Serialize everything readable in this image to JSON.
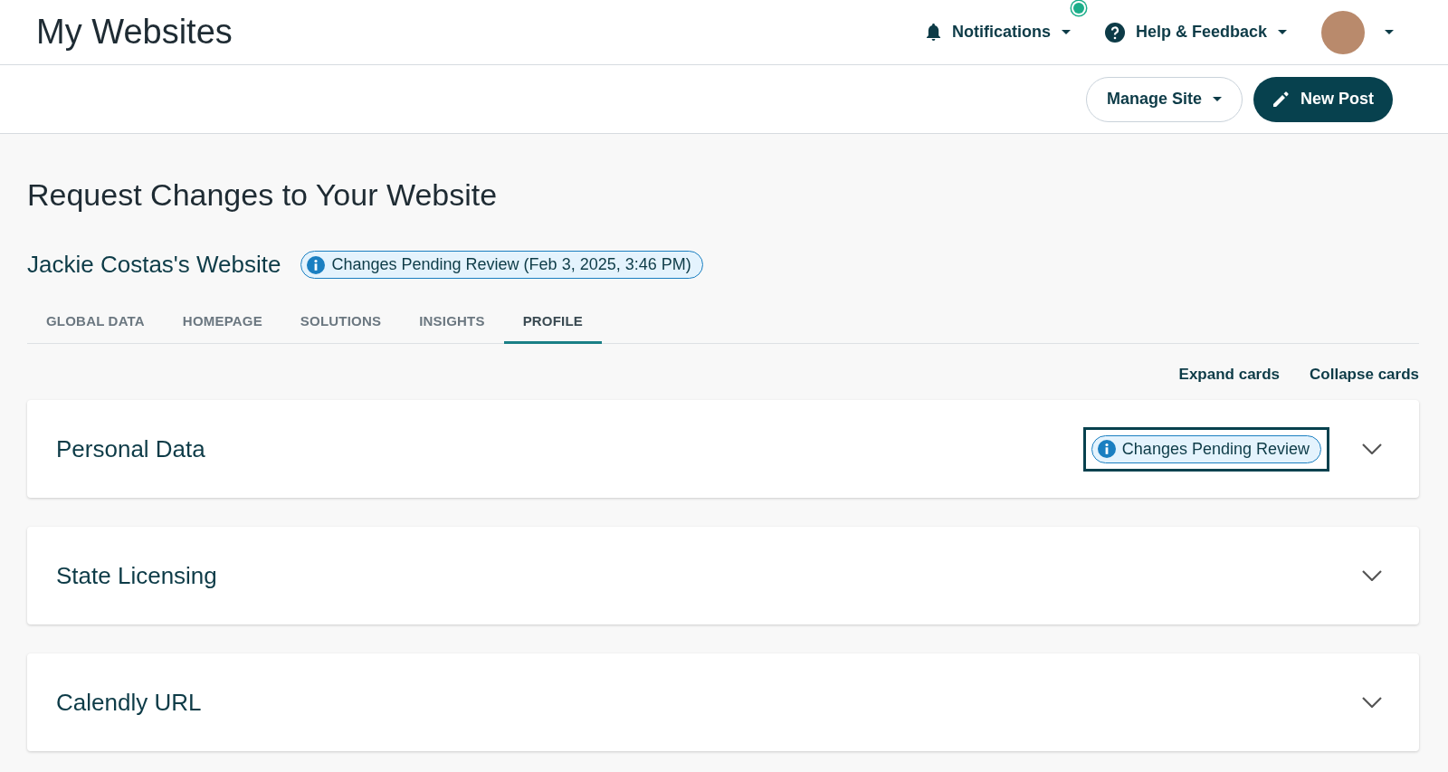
{
  "header": {
    "title": "My Websites",
    "notifications": {
      "label": "Notifications",
      "has_new": true
    },
    "help": {
      "label": "Help & Feedback"
    }
  },
  "toolbar": {
    "buttons": [
      {
        "label": "Manage Site",
        "kind": "dropdown"
      },
      {
        "label": "New Post",
        "kind": "primary"
      }
    ]
  },
  "page": {
    "title": "Request Changes to Your Website",
    "site_name": "Jackie Costas's Website",
    "status_badge": "Changes Pending Review (Feb 3, 2025, 3:46 PM)"
  },
  "tabs": [
    {
      "label": "GLOBAL DATA",
      "selected": false
    },
    {
      "label": "HOMEPAGE",
      "selected": false
    },
    {
      "label": "SOLUTIONS",
      "selected": false
    },
    {
      "label": "INSIGHTS",
      "selected": false
    },
    {
      "label": "PROFILE",
      "selected": true
    }
  ],
  "card_actions": [
    "Expand cards",
    "Collapse cards"
  ],
  "cards": [
    {
      "title": "Personal Data",
      "badge": "Changes Pending Review",
      "badge_focused": true,
      "expanded": false
    },
    {
      "title": "State Licensing",
      "expanded": false
    },
    {
      "title": "Calendly URL",
      "expanded": false
    }
  ]
}
